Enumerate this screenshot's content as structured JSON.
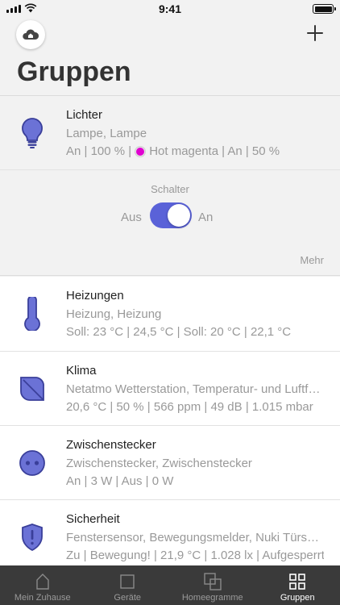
{
  "status_bar": {
    "time": "9:41"
  },
  "header": {
    "title": "Gruppen"
  },
  "expanded_group": {
    "name": "Lichter",
    "devices": "Lampe, Lampe",
    "state_before": "An | 100 % |",
    "color_name": "Hot magenta",
    "state_after": "| An | 50 %",
    "color_value": "#e000d0",
    "switch": {
      "label": "Schalter",
      "off_label": "Aus",
      "on_label": "An",
      "is_on": true
    },
    "more_label": "Mehr"
  },
  "groups": [
    {
      "name": "Heizungen",
      "devices": "Heizung, Heizung",
      "state": "Soll: 23 °C | 24,5 °C | Soll: 20 °C | 22,1 °C",
      "icon": "thermometer-icon"
    },
    {
      "name": "Klima",
      "devices": "Netatmo Wetterstation, Temperatur- und Luftfeuchtigkeitssensor",
      "state": "20,6 °C | 50 % | 566 ppm | 49 dB | 1.015 mbar",
      "icon": "leaf-icon"
    },
    {
      "name": "Zwischenstecker",
      "devices": "Zwischenstecker, Zwischenstecker",
      "state": "An | 3 W | Aus | 0 W",
      "icon": "plug-icon"
    },
    {
      "name": "Sicherheit",
      "devices": "Fenstersensor, Bewegungsmelder, Nuki Türschloss",
      "state": "Zu | Bewegung! | 21,9 °C | 1.028 lx | Aufgesperrt",
      "icon": "shield-icon"
    }
  ],
  "tabs": [
    {
      "label": "Mein Zuhause",
      "icon": "house-icon",
      "active": false
    },
    {
      "label": "Geräte",
      "icon": "square-icon",
      "active": false
    },
    {
      "label": "Homeegramme",
      "icon": "overlapping-squares-icon",
      "active": false
    },
    {
      "label": "Gruppen",
      "icon": "grid-icon",
      "active": true
    }
  ],
  "colors": {
    "accent": "#5a62d8",
    "tabbar": "#3a3a3a",
    "icon_fill": "#6b72d6"
  }
}
